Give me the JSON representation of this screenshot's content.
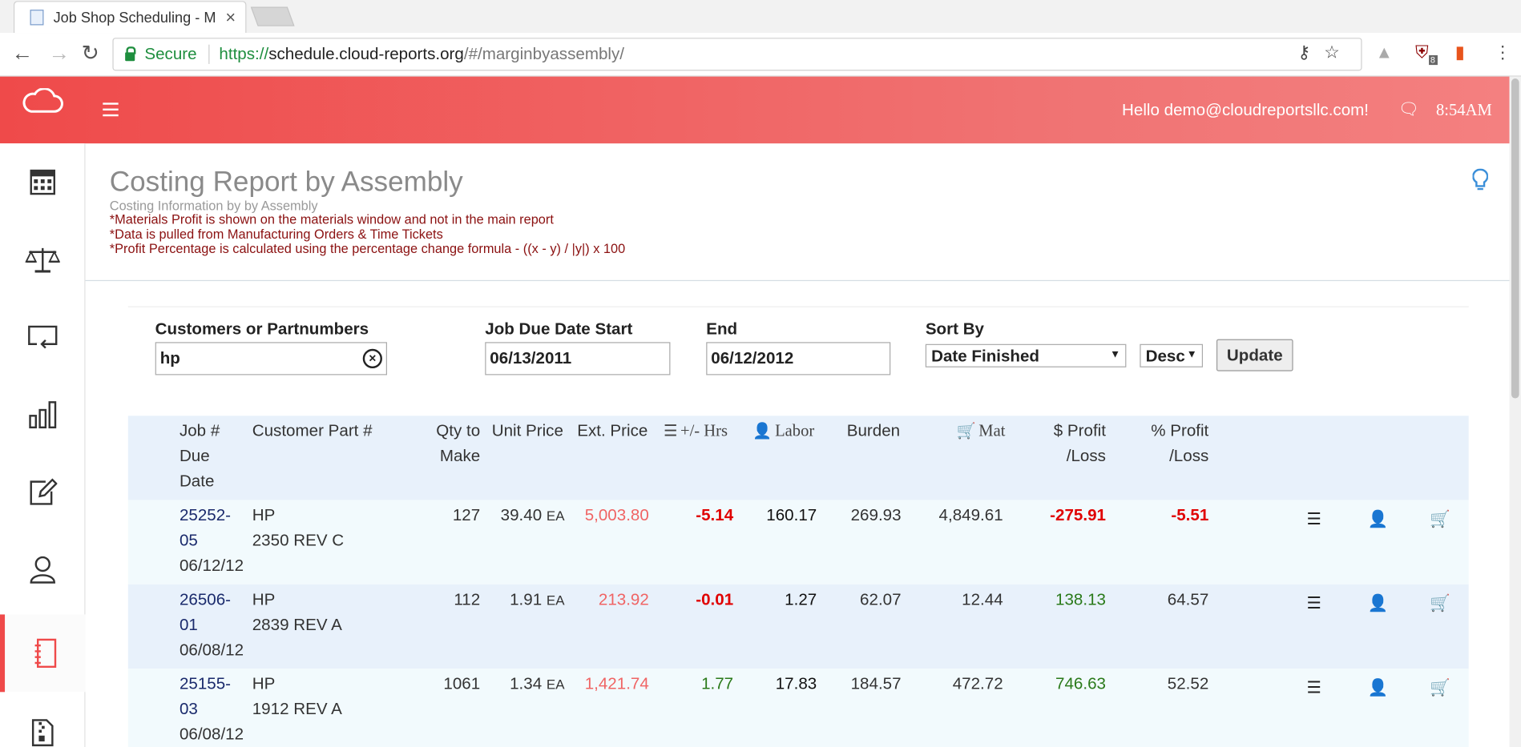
{
  "browser": {
    "tab_title": "Job Shop Scheduling - M",
    "secure_label": "Secure",
    "url_scheme": "https://",
    "url_host": "schedule.cloud-reports.org",
    "url_path": "/#/marginbyassembly/",
    "ext_badge": "8"
  },
  "header": {
    "greeting": "Hello demo@cloudreportsllc.com!",
    "time": "8:54AM"
  },
  "sidebar": {
    "items": [
      {
        "icon": "calculator-icon"
      },
      {
        "icon": "scale-icon"
      },
      {
        "icon": "screen-return-icon"
      },
      {
        "icon": "bar-chart-icon"
      },
      {
        "icon": "edit-icon"
      },
      {
        "icon": "user-icon"
      },
      {
        "icon": "notebook-icon",
        "active": true
      },
      {
        "icon": "zip-file-icon"
      }
    ]
  },
  "page": {
    "title": "Costing Report by Assembly",
    "subtitle": "Costing Information by by Assembly",
    "notes": [
      "*Materials Profit is shown on the materials window and not in the main report",
      "*Data is pulled from Manufacturing Orders & Time Tickets",
      "*Profit Percentage is calculated using the percentage change formula - ((x - y) / |y|) x 100"
    ]
  },
  "filters": {
    "customers_label": "Customers or Partnumbers",
    "customers_value": "hp",
    "start_label": "Job Due Date Start",
    "start_value": "06/13/2011",
    "end_label": "End",
    "end_value": "06/12/2012",
    "sort_label": "Sort By",
    "sort_value": "Date Finished",
    "order_value": "Desc",
    "update_label": "Update"
  },
  "table": {
    "headers": {
      "job_1": "Job #",
      "job_2": "Due",
      "job_3": "Date",
      "part": "Customer Part #",
      "qty_1": "Qty to",
      "qty_2": "Make",
      "unit": "Unit Price",
      "ext": "Ext. Price",
      "hrs": "+/- Hrs",
      "labor": "Labor",
      "burden": "Burden",
      "mat": "Mat",
      "profit_1": "$ Profit",
      "profit_2": "/Loss",
      "pct_1": "% Profit",
      "pct_2": "/Loss"
    },
    "rows": [
      {
        "job_a": "25252-",
        "job_b": "05",
        "date": "06/12/12",
        "cust": "HP",
        "part": "2350 REV C",
        "qty": "127",
        "unit": "39.40",
        "uom": "EA",
        "ext": "5,003.80",
        "hrs": "-5.14",
        "labor": "160.17",
        "burden": "269.93",
        "mat": "4,849.61",
        "profit": "-275.91",
        "pct": "-5.51"
      },
      {
        "job_a": "26506-",
        "job_b": "01",
        "date": "06/08/12",
        "cust": "HP",
        "part": "2839 REV A",
        "qty": "112",
        "unit": "1.91",
        "uom": "EA",
        "ext": "213.92",
        "hrs": "-0.01",
        "labor": "1.27",
        "burden": "62.07",
        "mat": "12.44",
        "profit": "138.13",
        "pct": "64.57"
      },
      {
        "job_a": "25155-",
        "job_b": "03",
        "date": "06/08/12",
        "cust": "HP",
        "part": "1912 REV A",
        "qty": "1061",
        "unit": "1.34",
        "uom": "EA",
        "ext": "1,421.74",
        "hrs": "1.77",
        "labor": "17.83",
        "burden": "184.57",
        "mat": "472.72",
        "profit": "746.63",
        "pct": "52.52"
      }
    ]
  },
  "colors": {
    "accent": "#ef4a4a",
    "negative": "#e00000",
    "positive": "#2a7a1a",
    "ext_price": "#f06464",
    "note": "#8b1111"
  }
}
